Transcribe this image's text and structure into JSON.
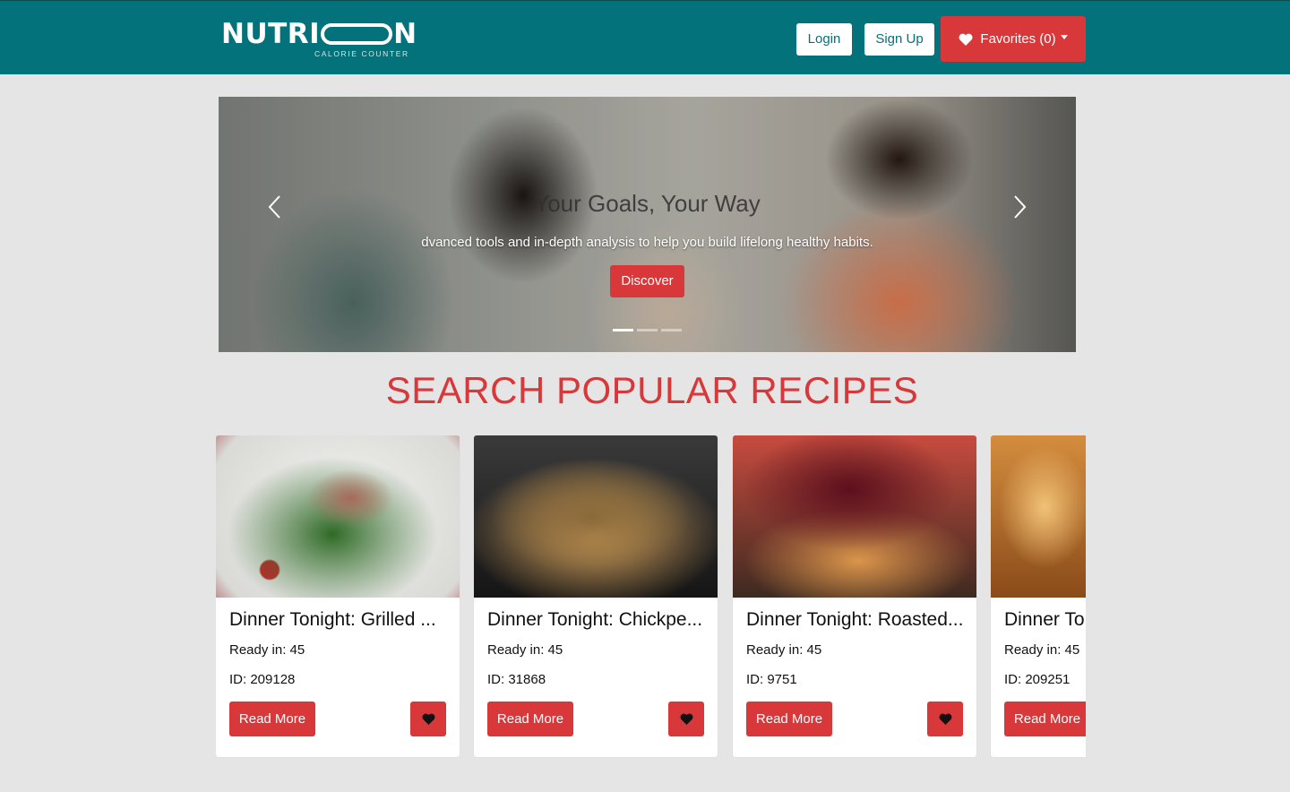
{
  "brand": {
    "name_left": "NUTRI",
    "name_right": "N",
    "tagline": "CALORIE COUNTER"
  },
  "nav": {
    "login_label": "Login",
    "signup_label": "Sign Up",
    "favorites_label": "Favorites (0)"
  },
  "carousel": {
    "title": "Your Goals, Your Way",
    "subtitle": "dvanced tools and in-depth analysis to help you build lifelong healthy habits.",
    "cta_label": "Discover",
    "active_slide": 1,
    "slide_count": 3
  },
  "section": {
    "title": "SEARCH POPULAR RECIPES"
  },
  "recipes": [
    {
      "title": "Dinner Tonight: Grilled ...",
      "ready": "Ready in: 45",
      "id": "ID: 209128",
      "read_label": "Read More"
    },
    {
      "title": "Dinner Tonight: Chickpe...",
      "ready": "Ready in: 45",
      "id": "ID: 31868",
      "read_label": "Read More"
    },
    {
      "title": "Dinner Tonight: Roasted...",
      "ready": "Ready in: 45",
      "id": "ID: 9751",
      "read_label": "Read More"
    },
    {
      "title": "Dinner To",
      "ready": "Ready in: 45",
      "id": "ID: 209251",
      "read_label": "Read More"
    }
  ],
  "colors": {
    "navbar": "#03727a",
    "accent_red": "#d9383a",
    "page_bg": "#e5e5e5"
  },
  "icons": {
    "favorites": "heart-icon",
    "dropdown": "caret-down-icon",
    "prev": "chevron-left-icon",
    "next": "chevron-right-icon",
    "card_favorite": "heart-icon"
  }
}
